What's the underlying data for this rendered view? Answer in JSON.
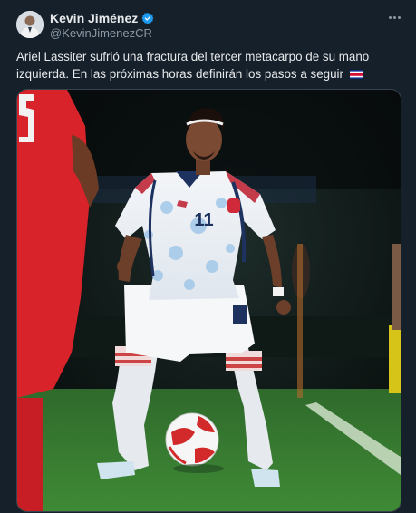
{
  "tweet": {
    "author_name": "Kevin Jiménez",
    "handle": "@KevinJimenezCR",
    "text": "Ariel Lassiter sufrió una fractura del tercer metacarpo de su mano izquierda. En las próximas horas definirán los pasos a seguir",
    "flag": "Costa Rica flag emoji",
    "media_description": "Soccer player in white and blue number 11 kit dribbling a ball on a field at night",
    "jersey_number": "11"
  },
  "icons": {
    "verified": "verified-badge-icon",
    "more": "more-options-icon"
  },
  "colors": {
    "background": "#15202b",
    "text": "#e7e9ea",
    "secondary_text": "#8b98a5",
    "verified": "#1d9bf0",
    "border": "#38444d"
  }
}
